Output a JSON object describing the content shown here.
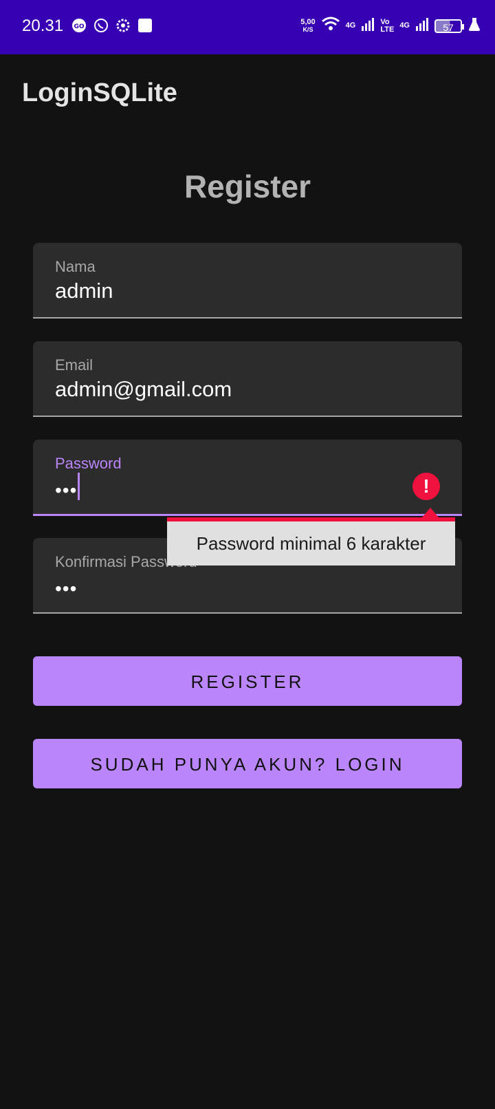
{
  "status_bar": {
    "time": "20.31",
    "net_speed_value": "5,00",
    "net_speed_unit": "K/S",
    "signal_1_tag": "4G",
    "volte_tag_top": "Vo",
    "volte_tag_bottom": "LTE",
    "signal_2_tag": "4G",
    "battery_level": "57",
    "background_color": "#3700b3"
  },
  "app_bar": {
    "title": "LoginSQLite"
  },
  "form": {
    "heading": "Register",
    "fields": [
      {
        "label": "Nama",
        "value": "admin"
      },
      {
        "label": "Email",
        "value": "admin@gmail.com"
      },
      {
        "label": "Password",
        "value": "•••"
      },
      {
        "label": "Konfirmasi Password",
        "value": "•••"
      }
    ],
    "error_message": "Password minimal 6 karakter",
    "register_button": "REGISTER",
    "login_button": "SUDAH PUNYA AKUN? LOGIN"
  },
  "colors": {
    "accent": "#bb86fc",
    "error": "#f0113e",
    "background": "#121212",
    "field_background": "#2c2c2c"
  }
}
